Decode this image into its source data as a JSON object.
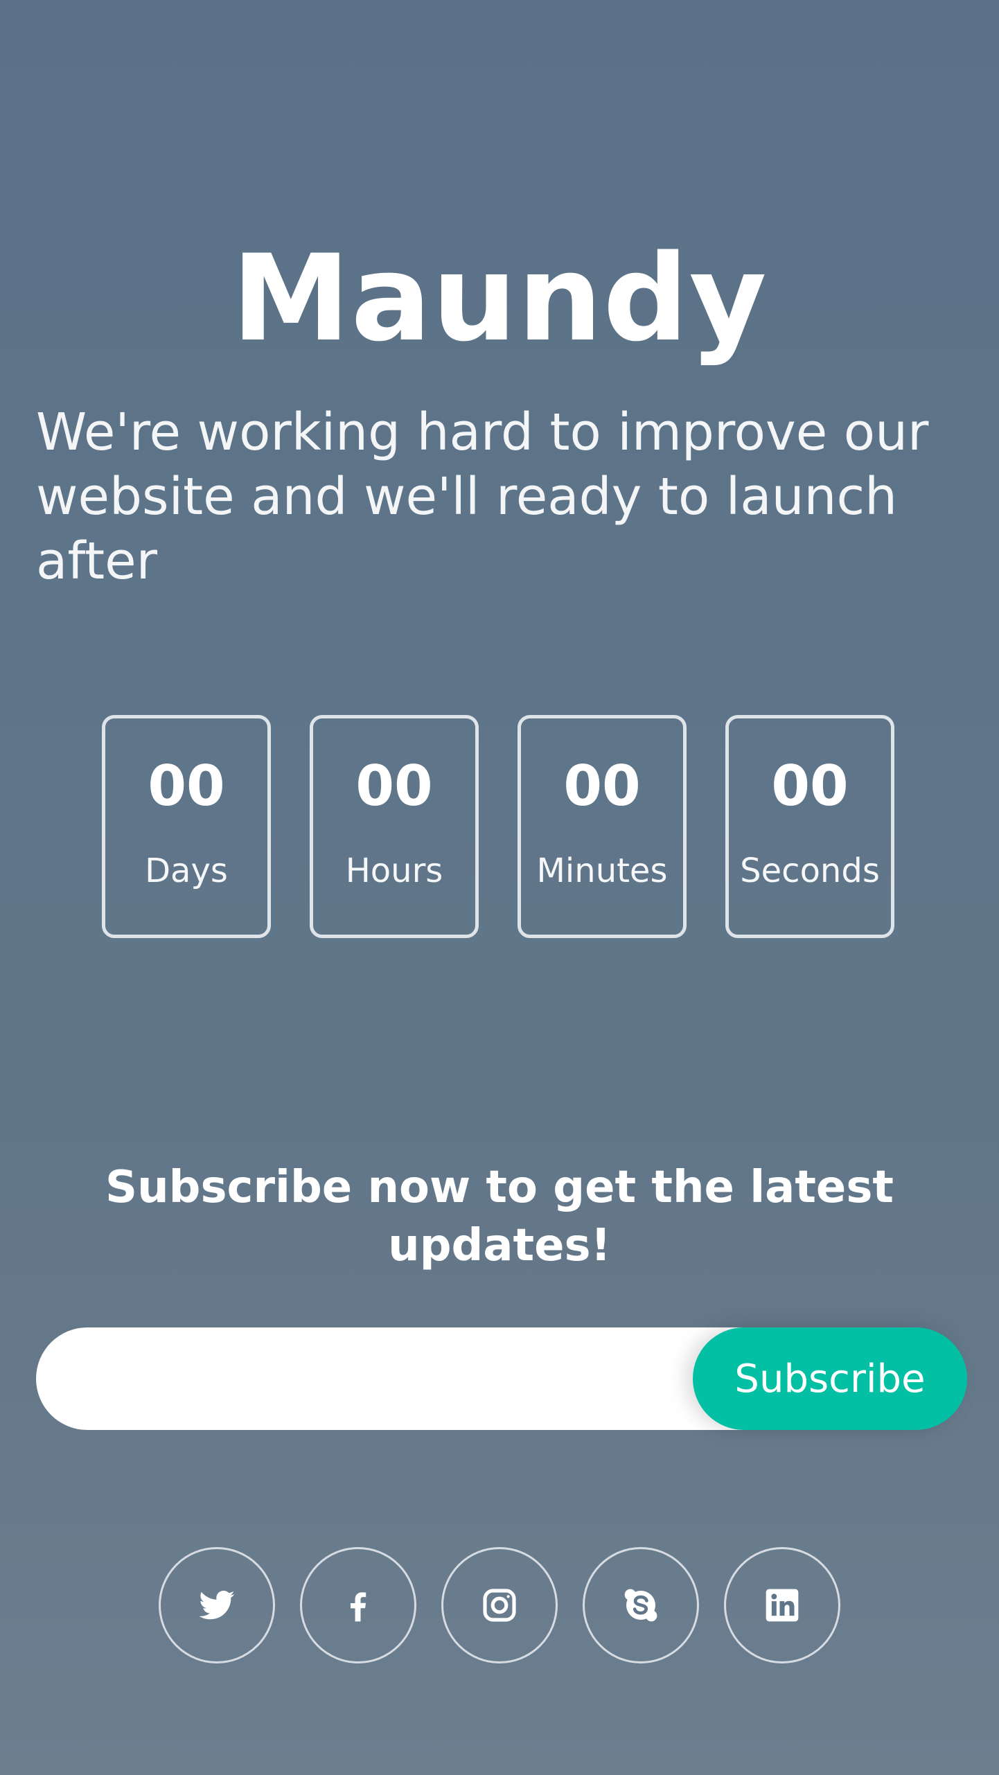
{
  "brand": "Maundy",
  "tagline": "We're working hard to improve our website and we'll ready to launch after",
  "countdown": [
    {
      "value": "00",
      "label": "Days"
    },
    {
      "value": "00",
      "label": "Hours"
    },
    {
      "value": "00",
      "label": "Minutes"
    },
    {
      "value": "00",
      "label": "Seconds"
    }
  ],
  "subscribe": {
    "title": "Subscribe now to get the latest updates!",
    "input_value": "",
    "button_label": "Subscribe",
    "button_color": "#03bfa4"
  },
  "social": [
    {
      "name": "twitter-icon"
    },
    {
      "name": "facebook-icon"
    },
    {
      "name": "instagram-icon"
    },
    {
      "name": "skype-icon"
    },
    {
      "name": "linkedin-icon"
    }
  ]
}
